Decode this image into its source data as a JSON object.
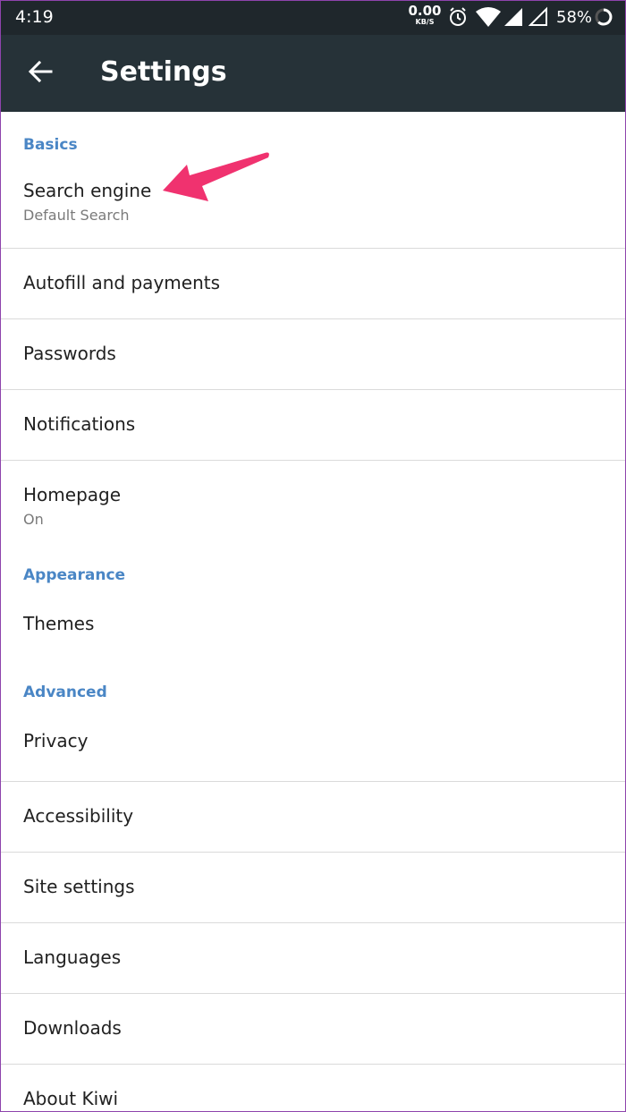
{
  "status_bar": {
    "time": "4:19",
    "network_speed_value": "0.00",
    "network_speed_unit": "KB/S",
    "battery_percent": "58%",
    "icons": [
      "alarm-icon",
      "wifi-icon",
      "signal-icon",
      "signal-empty-icon",
      "battery-ring-icon"
    ]
  },
  "app_bar": {
    "title": "Settings",
    "back_icon": "arrow-left-icon",
    "background": "#263238"
  },
  "sections": {
    "basics": "Basics",
    "appearance": "Appearance",
    "advanced": "Advanced"
  },
  "items": {
    "search_engine": {
      "label": "Search engine",
      "summary": "Default Search"
    },
    "autofill": {
      "label": "Autofill and payments"
    },
    "passwords": {
      "label": "Passwords"
    },
    "notifications": {
      "label": "Notifications"
    },
    "homepage": {
      "label": "Homepage",
      "summary": "On"
    },
    "themes": {
      "label": "Themes"
    },
    "privacy": {
      "label": "Privacy"
    },
    "accessibility": {
      "label": "Accessibility"
    },
    "site_settings": {
      "label": "Site settings"
    },
    "languages": {
      "label": "Languages"
    },
    "downloads": {
      "label": "Downloads"
    },
    "about": {
      "label": "About Kiwi"
    }
  },
  "colors": {
    "section_header": "#4a86c5",
    "annotation_arrow": "#f0326f"
  }
}
